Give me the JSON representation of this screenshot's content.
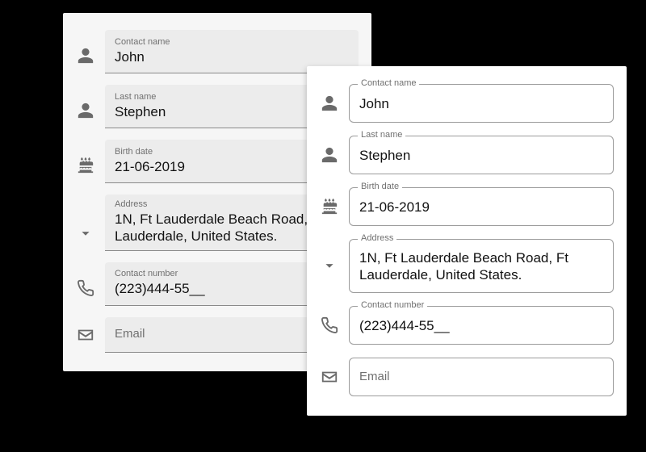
{
  "filled": {
    "contact_name": {
      "label": "Contact name",
      "value": "John"
    },
    "last_name": {
      "label": "Last name",
      "value": "Stephen"
    },
    "birth_date": {
      "label": "Birth date",
      "value": "21-06-2019"
    },
    "address": {
      "label": "Address",
      "value": "1N, Ft Lauderdale Beach Road, Lauderdale, United States."
    },
    "contact_number": {
      "label": "Contact number",
      "value": "(223)444-55__"
    },
    "email": {
      "label": "Email",
      "value": ""
    }
  },
  "outlined": {
    "contact_name": {
      "label": "Contact name",
      "value": "John"
    },
    "last_name": {
      "label": "Last name",
      "value": "Stephen"
    },
    "birth_date": {
      "label": "Birth date",
      "value": "21-06-2019"
    },
    "address": {
      "label": "Address",
      "value": "1N, Ft Lauderdale Beach Road, Ft Lauderdale, United States."
    },
    "contact_number": {
      "label": "Contact number",
      "value": "(223)444-55__"
    },
    "email": {
      "label": "Email",
      "value": ""
    }
  }
}
